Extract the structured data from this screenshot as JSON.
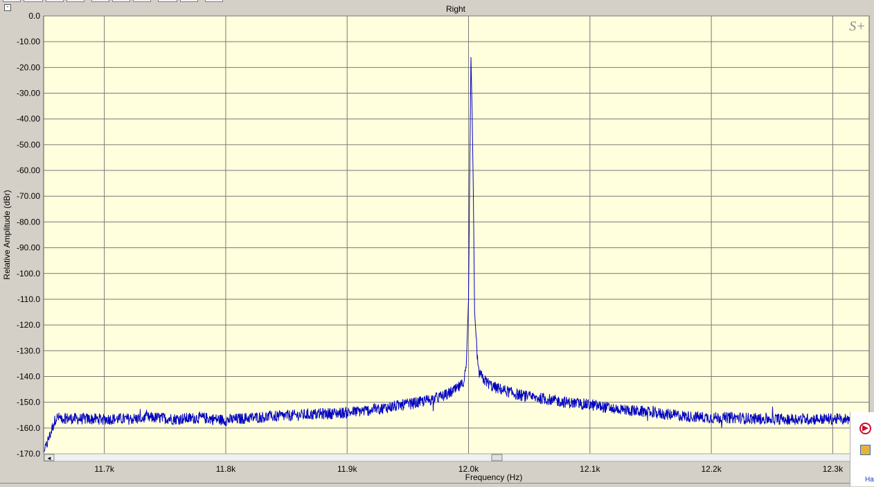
{
  "window": {
    "title": "Right",
    "logo": "S+"
  },
  "chart_data": {
    "type": "line",
    "title": "Right",
    "xlabel": "Frequency (Hz)",
    "ylabel": "Relative Amplitude (dBr)",
    "xlim": [
      11650,
      12330
    ],
    "ylim": [
      -170,
      0
    ],
    "x_ticks": [
      {
        "value": 11700,
        "label": "11.7k"
      },
      {
        "value": 11800,
        "label": "11.8k"
      },
      {
        "value": 11900,
        "label": "11.9k"
      },
      {
        "value": 12000,
        "label": "12.0k"
      },
      {
        "value": 12100,
        "label": "12.1k"
      },
      {
        "value": 12200,
        "label": "12.2k"
      },
      {
        "value": 12300,
        "label": "12.3k"
      }
    ],
    "y_ticks": [
      {
        "value": 0,
        "label": "0.0"
      },
      {
        "value": -10,
        "label": "-10.00"
      },
      {
        "value": -20,
        "label": "-20.00"
      },
      {
        "value": -30,
        "label": "-30.00"
      },
      {
        "value": -40,
        "label": "-40.00"
      },
      {
        "value": -50,
        "label": "-50.00"
      },
      {
        "value": -60,
        "label": "-60.00"
      },
      {
        "value": -70,
        "label": "-70.00"
      },
      {
        "value": -80,
        "label": "-80.00"
      },
      {
        "value": -90,
        "label": "-90.00"
      },
      {
        "value": -100,
        "label": "-100.0"
      },
      {
        "value": -110,
        "label": "-110.0"
      },
      {
        "value": -120,
        "label": "-120.0"
      },
      {
        "value": -130,
        "label": "-130.0"
      },
      {
        "value": -140,
        "label": "-140.0"
      },
      {
        "value": -150,
        "label": "-150.0"
      },
      {
        "value": -160,
        "label": "-160.0"
      },
      {
        "value": -170,
        "label": "-170.0"
      }
    ],
    "grid": true,
    "series": [
      {
        "color": "#0000c0",
        "x": [
          11650,
          11660,
          11680,
          11700,
          11720,
          11740,
          11760,
          11780,
          11800,
          11820,
          11840,
          11860,
          11880,
          11900,
          11920,
          11940,
          11960,
          11980,
          11990,
          11995,
          11998,
          12000,
          12001,
          12002,
          12003,
          12004,
          12005,
          12008,
          12012,
          12020,
          12030,
          12040,
          12050,
          12060,
          12080,
          12100,
          12120,
          12140,
          12160,
          12180,
          12200,
          12220,
          12240,
          12260,
          12280,
          12300,
          12320,
          12330
        ],
        "y": [
          -170,
          -156,
          -156.5,
          -156.5,
          -156.5,
          -156,
          -156.5,
          -156,
          -157,
          -156,
          -155.5,
          -155,
          -154.5,
          -154,
          -153,
          -151.5,
          -150,
          -147.5,
          -145,
          -143,
          -138,
          -110,
          -60,
          -16,
          -38,
          -70,
          -115,
          -138,
          -141,
          -144,
          -145.5,
          -147,
          -148,
          -148.5,
          -150,
          -151,
          -152.5,
          -153.5,
          -154.5,
          -155.5,
          -156,
          -156,
          -156.5,
          -156.5,
          -156.5,
          -156.5,
          -156.5,
          -157
        ]
      }
    ]
  },
  "scrollbar": {
    "left_arrow": "◄"
  },
  "side_panel": {
    "text": "Ha"
  }
}
